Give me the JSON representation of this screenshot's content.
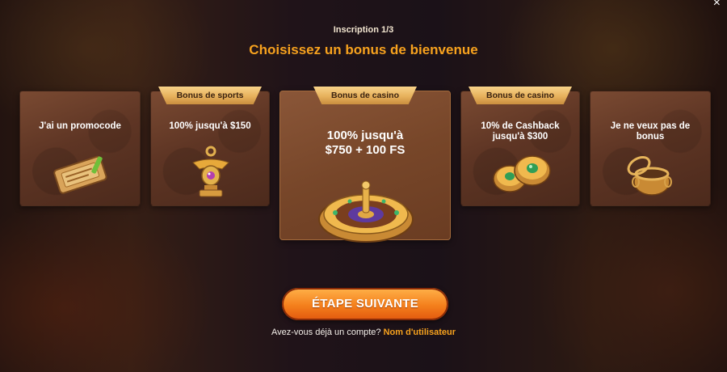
{
  "header": {
    "step_label": "Inscription 1/3",
    "title": "Choisissez un bonus de bienvenue",
    "close_symbol": "×"
  },
  "cards": [
    {
      "ribbon": "",
      "text": "J'ai un promocode",
      "icon": "ticket-icon"
    },
    {
      "ribbon": "Bonus de sports",
      "text": "100% jusqu'à $150",
      "icon": "trophy-icon"
    },
    {
      "ribbon": "Bonus de casino",
      "text": "100% jusqu'à $750 + 100 FS",
      "icon": "roulette-icon",
      "selected": true
    },
    {
      "ribbon": "Bonus de casino",
      "text": "10% de Cashback jusqu'à $300",
      "icon": "coins-icon"
    },
    {
      "ribbon": "",
      "text": "Je ne veux pas de bonus",
      "icon": "empty-pot-icon"
    }
  ],
  "footer": {
    "next_button": "ÉTAPE SUIVANTE",
    "login_prompt": "Avez-vous déjà un compte?",
    "login_link": "Nom d'utilisateur"
  },
  "colors": {
    "accent": "#f7a21e",
    "button": "#f47f1c",
    "ribbon": "#e7b15c",
    "card": "#5e3524"
  }
}
